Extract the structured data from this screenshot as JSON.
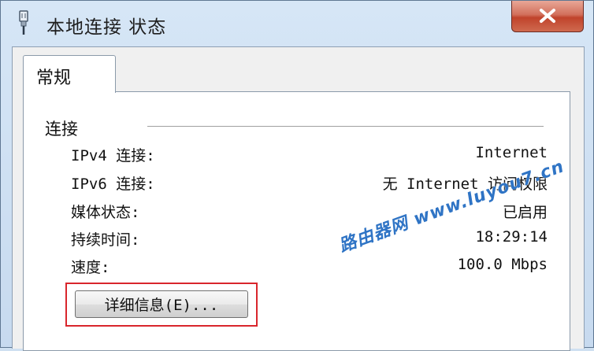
{
  "window": {
    "title": "本地连接 状态",
    "close_label": "✕"
  },
  "tabs": [
    {
      "label": "常规",
      "selected": true
    }
  ],
  "connection": {
    "group_label": "连接",
    "rows": [
      {
        "label": "IPv4 连接:",
        "value": "Internet"
      },
      {
        "label": "IPv6 连接:",
        "value": "无 Internet 访问权限"
      },
      {
        "label": "媒体状态:",
        "value": "已启用"
      },
      {
        "label": "持续时间:",
        "value": "18:29:14"
      },
      {
        "label": "速度:",
        "value": "100.0 Mbps"
      }
    ],
    "details_button": "详细信息(E)..."
  },
  "watermark": "路由器网 www.luyou7.cn",
  "colors": {
    "highlight": "#d9262c",
    "watermark": "#2f74c5",
    "titlebar": "#cfe0f1"
  }
}
